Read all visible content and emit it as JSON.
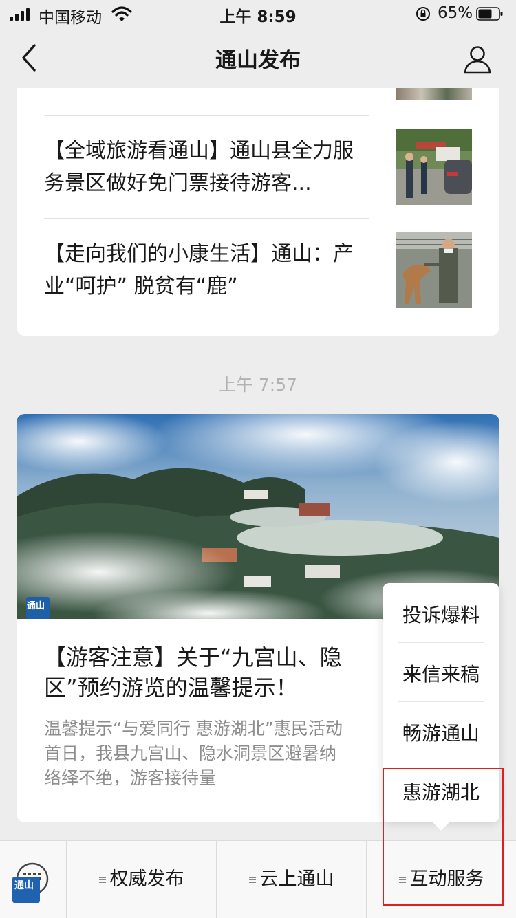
{
  "status_bar": {
    "carrier": "中国移动",
    "time": "上午 8:59",
    "battery": "65%",
    "icons": [
      "signal-icon",
      "wifi-icon",
      "orientation-lock-icon",
      "battery-icon"
    ]
  },
  "nav": {
    "title": "通山发布",
    "icons": [
      "back-arrow-icon",
      "profile-icon"
    ]
  },
  "articles": [
    {
      "title": "【全域旅游看通山】通山县全力服务景区做好免门票接待游客..."
    },
    {
      "title": "【走向我们的小康生活】通山：产业“呵护” 脱贫有“鹿”"
    }
  ],
  "timestamp": "上午 7:57",
  "featured": {
    "title": "【游客注意】关于“九宫山、隐\n区”预约游览的温馨提示！",
    "digest": "温馨提示“与爱同行 惠游湖北”惠民活动\n首日，我县九宫山、隐水洞景区避暑纳\n络绎不绝，游客接待量",
    "badge": "通山"
  },
  "popup_menu": {
    "items": [
      "投诉爆料",
      "来信来稿",
      "畅游通山",
      "惠游湖北"
    ]
  },
  "bottom_menu": {
    "keyboard_badge": "通山",
    "items": [
      "权威发布",
      "云上通山",
      "互动服务"
    ]
  },
  "colors": {
    "background": "#ededed",
    "highlight_box": "#e02020",
    "text": "#191919",
    "digest": "#8d8d8d"
  }
}
